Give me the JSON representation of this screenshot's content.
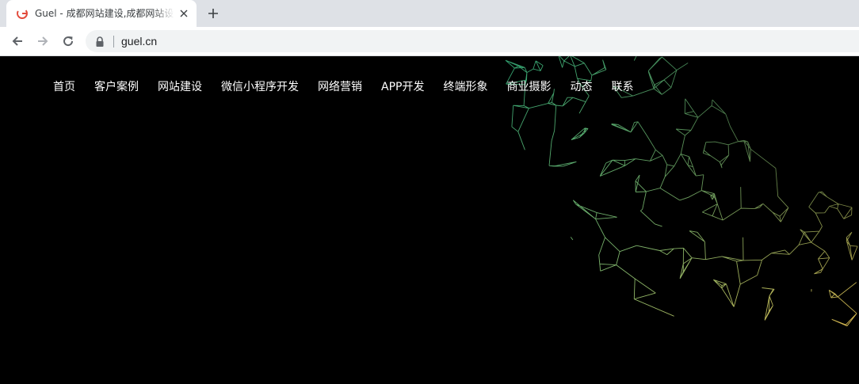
{
  "browser": {
    "tab": {
      "title": "Guel - 成都网站建设,成都网站设计",
      "favicon": "guel-favicon-icon",
      "close_icon": "close-icon"
    },
    "new_tab_icon": "plus-icon",
    "toolbar": {
      "back_icon": "arrow-left-icon",
      "forward_icon": "arrow-right-icon",
      "reload_icon": "reload-icon",
      "lock_icon": "lock-icon",
      "url": "guel.cn"
    }
  },
  "site": {
    "background_color": "#000000",
    "nav": [
      {
        "label": "首页"
      },
      {
        "label": "客户案例"
      },
      {
        "label": "网站建设"
      },
      {
        "label": "微信小程序开发"
      },
      {
        "label": "网络营销"
      },
      {
        "label": "APP开发"
      },
      {
        "label": "终端形象"
      },
      {
        "label": "商业摄影"
      },
      {
        "label": "动态"
      },
      {
        "label": "联系"
      }
    ],
    "hero_graphic": {
      "icon": "polygon-mesh-sphere",
      "colors": [
        "#2f9e6e",
        "#7fb36a",
        "#d6b64e"
      ]
    }
  }
}
